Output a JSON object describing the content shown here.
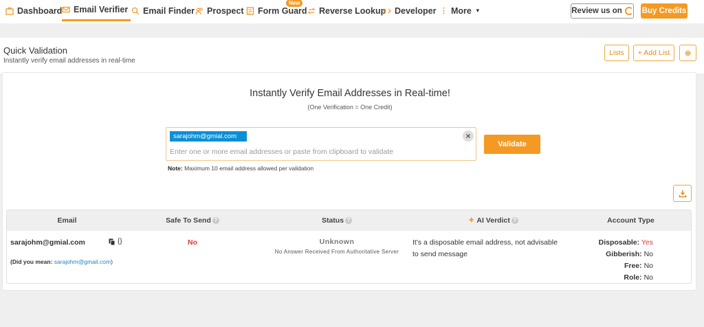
{
  "nav": {
    "items": [
      {
        "label": "Dashboard",
        "icon": "dashboard-icon"
      },
      {
        "label": "Email Verifier",
        "icon": "envelope-icon",
        "active": true
      },
      {
        "label": "Email Finder",
        "icon": "search-icon"
      },
      {
        "label": "Prospect",
        "icon": "users-icon"
      },
      {
        "label": "Form Guard",
        "icon": "form-icon",
        "badge": "New"
      },
      {
        "label": "Reverse Lookup",
        "icon": "swap-icon"
      },
      {
        "label": "Developer",
        "icon": "code-icon"
      },
      {
        "label": "More",
        "icon": "more-dots-icon"
      }
    ],
    "review_label": "Review us on",
    "buy_label": "Buy Credits"
  },
  "header": {
    "title": "Quick Validation",
    "subtitle": "Instantly verify email addresses in real-time",
    "lists_label": "Lists",
    "add_list_label": "+ Add List"
  },
  "validator": {
    "headline": "Instantly Verify Email Addresses in Real-time!",
    "subline": "(One Verification = One Credit)",
    "chip": "sarajohm@gmial.com",
    "placeholder": "Enter one or more email addresses or paste from clipboard to validate",
    "validate_label": "Validate",
    "note_label": "Note:",
    "note_text": "Maximum 10 email address allowed per validation"
  },
  "table": {
    "headers": [
      "Email",
      "Safe To Send",
      "Status",
      "AI Verdict",
      "Account Type"
    ],
    "row": {
      "email": "sarajohm@gmial.com",
      "json_label": "{}",
      "did_you_mean_label": "(Did you mean:",
      "did_you_mean_value": "sarajohm@gmail.com",
      "did_you_mean_close": ")",
      "safe_to_send": "No",
      "status": "Unknown",
      "status_detail": "No Answer Received From Authoritative Server",
      "verdict_line1": "It's a disposable email address, not advisable",
      "verdict_line2": "to send message",
      "account": [
        {
          "label": "Disposable:",
          "value": "Yes"
        },
        {
          "label": "Gibberish:",
          "value": "No"
        },
        {
          "label": "Free:",
          "value": "No"
        },
        {
          "label": "Role:",
          "value": "No"
        }
      ]
    }
  },
  "colors": {
    "accent": "#f49a24",
    "chip": "#0b8fd6",
    "danger": "#d93838",
    "link": "#1a82c4"
  }
}
